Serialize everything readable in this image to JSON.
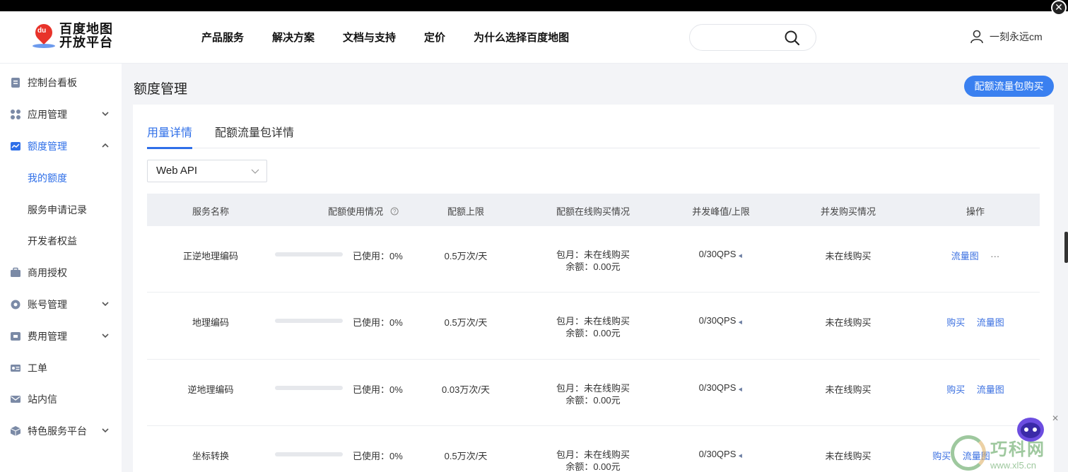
{
  "brand": {
    "line1": "百度地图",
    "line2": "开放平台",
    "mark": "du"
  },
  "nav": [
    "产品服务",
    "解决方案",
    "文档与支持",
    "定价",
    "为什么选择百度地图"
  ],
  "search": {
    "placeholder": ""
  },
  "user": {
    "name": "一刻永远cm"
  },
  "sidebar": [
    {
      "label": "控制台看板",
      "icon": "dashboard-icon",
      "expand": ""
    },
    {
      "label": "应用管理",
      "icon": "apps-icon",
      "expand": "down"
    },
    {
      "label": "额度管理",
      "icon": "chart-icon",
      "expand": "up",
      "active": true
    },
    {
      "label": "我的额度",
      "sub": true,
      "active": true
    },
    {
      "label": "服务申请记录",
      "sub": true
    },
    {
      "label": "开发者权益",
      "sub": true
    },
    {
      "label": "商用授权",
      "icon": "briefcase-icon",
      "expand": ""
    },
    {
      "label": "账号管理",
      "icon": "gear-icon",
      "expand": "down"
    },
    {
      "label": "费用管理",
      "icon": "wallet-icon",
      "expand": "down"
    },
    {
      "label": "工单",
      "icon": "ticket-icon",
      "expand": ""
    },
    {
      "label": "站内信",
      "icon": "mail-icon",
      "expand": ""
    },
    {
      "label": "特色服务平台",
      "icon": "cube-icon",
      "expand": "down"
    }
  ],
  "page": {
    "title": "额度管理",
    "buy_button": "配额流量包购买",
    "tabs": [
      "用量详情",
      "配额流量包详情"
    ],
    "active_tab": 0,
    "service_type": "Web API"
  },
  "table": {
    "headers": [
      "服务名称",
      "配额使用情况",
      "配额上限",
      "配额在线购买情况",
      "并发峰值/上限",
      "并发购买情况",
      "操作"
    ],
    "rows": [
      {
        "name": "正逆地理编码",
        "usage_fraction": 0,
        "used": "已使用：0%",
        "limit": "0.5万次/天",
        "buy1": "包月：未在线购买",
        "buy2": "余额：0.00元",
        "qps": "0/30QPS",
        "qps_buy": "未在线购买",
        "ops": [
          "流量图",
          "···"
        ]
      },
      {
        "name": "地理编码",
        "usage_fraction": 0,
        "used": "已使用：0%",
        "limit": "0.5万次/天",
        "buy1": "包月：未在线购买",
        "buy2": "余额：0.00元",
        "qps": "0/30QPS",
        "qps_buy": "未在线购买",
        "ops": [
          "购买",
          "流量图"
        ]
      },
      {
        "name": "逆地理编码",
        "usage_fraction": 0,
        "used": "已使用：0%",
        "limit": "0.03万次/天",
        "buy1": "包月：未在线购买",
        "buy2": "余额：0.00元",
        "qps": "0/30QPS",
        "qps_buy": "未在线购买",
        "ops": [
          "购买",
          "流量图"
        ]
      },
      {
        "name": "坐标转换",
        "usage_fraction": 0,
        "used": "已使用：0%",
        "limit": "0.5万次/天",
        "buy1": "包月：未在线购买",
        "buy2": "余额：0.00元",
        "qps": "0/30QPS",
        "qps_buy": "未在线购买",
        "ops": [
          "购买",
          "流量图"
        ]
      }
    ]
  },
  "watermark": {
    "big": "巧科网",
    "small": "www.xl5.cn"
  },
  "colors": {
    "accent": "#2f6fe8",
    "button": "#3a80f0",
    "link": "#3a6fe0"
  }
}
